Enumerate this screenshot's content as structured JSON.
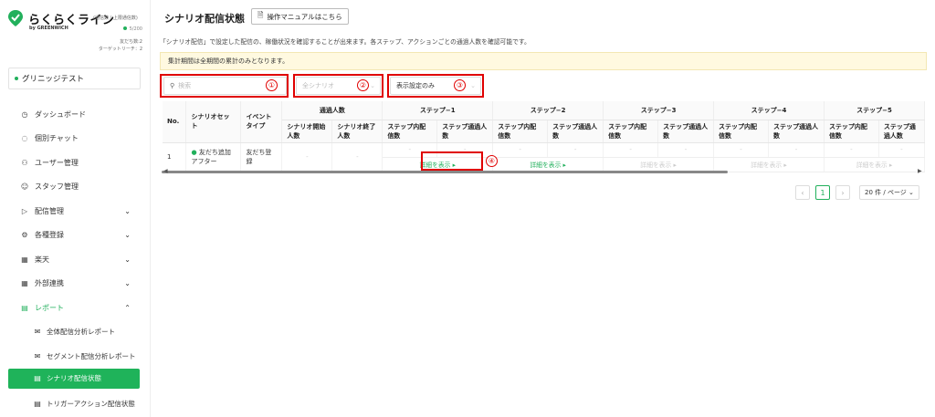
{
  "brand": {
    "name": "らくらくライン",
    "byline": "by GREENWICH",
    "note": "(通信数 / 上限通信数)",
    "quota": "5/200",
    "friends": "友だち数:2",
    "target_reach": "ターゲットリーチ：2"
  },
  "account": {
    "name": "グリニッジテスト"
  },
  "sidebar": {
    "items": [
      {
        "label": "ダッシュボード",
        "icon": "clock-icon"
      },
      {
        "label": "個別チャット",
        "icon": "chat-icon"
      },
      {
        "label": "ユーザー管理",
        "icon": "users-icon"
      },
      {
        "label": "スタッフ管理",
        "icon": "person-icon"
      },
      {
        "label": "配信管理",
        "icon": "send-icon"
      },
      {
        "label": "各種登録",
        "icon": "gear-icon"
      },
      {
        "label": "楽天",
        "icon": "grid-icon"
      },
      {
        "label": "外部連携",
        "icon": "grid-icon"
      },
      {
        "label": "レポート",
        "icon": "report-icon"
      }
    ],
    "subitems": [
      {
        "label": "全体配信分析レポート",
        "icon": "mail-icon"
      },
      {
        "label": "セグメント配信分析レポート",
        "icon": "mail-icon"
      },
      {
        "label": "シナリオ配信状態",
        "icon": "doc-icon"
      },
      {
        "label": "トリガーアクション配信状態",
        "icon": "doc-icon"
      }
    ]
  },
  "header": {
    "title": "シナリオ配信状態",
    "manual_button": "操作マニュアルはこちら",
    "description": "「シナリオ配信」で設定した配信の、稼働状況を確認することが出来ます。各ステップ、アクションごとの通過人数を確認可能です。",
    "notice": "集計期間は全期間の累計のみとなります。"
  },
  "filters": {
    "search_placeholder": "検索",
    "scenario_placeholder": "全シナリオ",
    "display_settings": "表示設定のみ"
  },
  "annotations": [
    "①",
    "②",
    "③",
    "④"
  ],
  "table": {
    "headers": {
      "no": "No.",
      "scenario_set": "シナリオセット",
      "event_type": "イベントタイプ",
      "passed": "通過人数",
      "start": "シナリオ開始人数",
      "end": "シナリオ終了人数",
      "step1": "ステップ−1",
      "step2": "ステップ−2",
      "step3": "ステップ−3",
      "step4": "ステップ−4",
      "step5": "ステップ−5",
      "sent": "ステップ内配信数",
      "through": "ステップ通過人数"
    },
    "row": {
      "no": "1",
      "scenario": "友だち追加アフター",
      "event": "友だち登録",
      "start": "-",
      "end": "-",
      "dash": "-",
      "detail": "詳細を表示 ▸"
    }
  },
  "pager": {
    "current": "1",
    "per_page": "20 件 / ページ ⌄",
    "prev": "‹",
    "next": "›"
  },
  "colors": {
    "accent": "#22b05c",
    "highlight": "#e00000"
  }
}
